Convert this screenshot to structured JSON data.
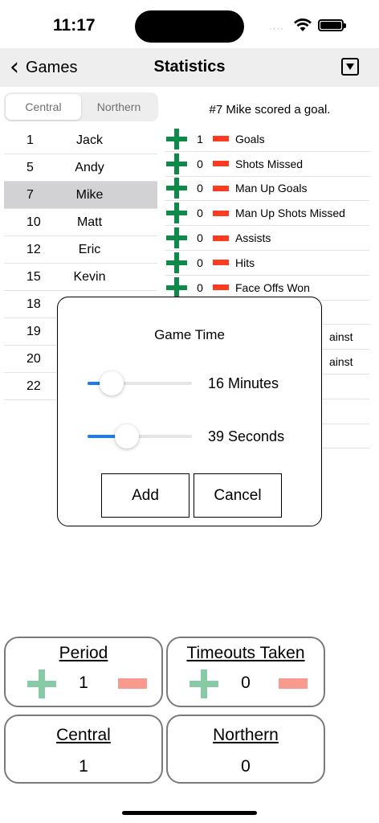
{
  "status_bar": {
    "time": "11:17",
    "signal": "····"
  },
  "nav": {
    "back_label": "Games",
    "title": "Statistics"
  },
  "segments": {
    "items": [
      "Central",
      "Northern"
    ],
    "selected": "Central"
  },
  "roster": [
    {
      "number": "1",
      "name": "Jack",
      "selected": false
    },
    {
      "number": "5",
      "name": "Andy",
      "selected": false
    },
    {
      "number": "7",
      "name": "Mike",
      "selected": true
    },
    {
      "number": "10",
      "name": "Matt",
      "selected": false
    },
    {
      "number": "12",
      "name": "Eric",
      "selected": false
    },
    {
      "number": "15",
      "name": "Kevin",
      "selected": false
    },
    {
      "number": "18",
      "name": "",
      "selected": false
    },
    {
      "number": "19",
      "name": "",
      "selected": false
    },
    {
      "number": "20",
      "name": "",
      "selected": false
    },
    {
      "number": "22",
      "name": "",
      "selected": false
    }
  ],
  "event_message": "#7 Mike scored a goal.",
  "stats": [
    {
      "value": "1",
      "label": "Goals"
    },
    {
      "value": "0",
      "label": "Shots Missed"
    },
    {
      "value": "0",
      "label": "Man Up Goals"
    },
    {
      "value": "0",
      "label": "Man Up Shots Missed"
    },
    {
      "value": "0",
      "label": "Assists"
    },
    {
      "value": "0",
      "label": "Hits"
    },
    {
      "value": "0",
      "label": "Face Offs Won"
    },
    {
      "value": "",
      "label": ""
    },
    {
      "value": "",
      "label": "ainst"
    },
    {
      "value": "",
      "label": "ainst"
    },
    {
      "value": "",
      "label": ""
    },
    {
      "value": "",
      "label": ""
    },
    {
      "value": "",
      "label": ""
    }
  ],
  "modal": {
    "title": "Game Time",
    "minutes": {
      "value": 16,
      "fraction": 0.23,
      "label": "16 Minutes"
    },
    "seconds": {
      "value": 39,
      "fraction": 0.38,
      "label": "39 Seconds"
    },
    "add_label": "Add",
    "cancel_label": "Cancel"
  },
  "period_card": {
    "title": "Period",
    "value": "1"
  },
  "timeouts_card": {
    "title": "Timeouts Taken",
    "value": "0"
  },
  "central_card": {
    "title": "Central",
    "value": "1"
  },
  "northern_card": {
    "title": "Northern",
    "value": "0"
  },
  "colors": {
    "plus_green": "#0d8a4a",
    "minus_red": "#ff3b1f",
    "slider_blue": "#1a7bf2",
    "light_plus": "#86cba6",
    "light_minus": "#f89a8d"
  }
}
